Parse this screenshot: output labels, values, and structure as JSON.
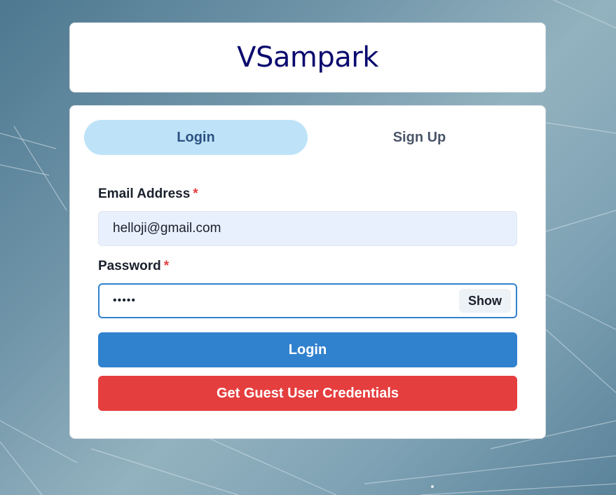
{
  "app": {
    "title": "VSampark"
  },
  "tabs": [
    {
      "label": "Login",
      "active": true
    },
    {
      "label": "Sign Up",
      "active": false
    }
  ],
  "form": {
    "email": {
      "label": "Email Address",
      "required_mark": "*",
      "value": "helloji@gmail.com"
    },
    "password": {
      "label": "Password",
      "required_mark": "*",
      "masked_value": "•••••",
      "toggle_label": "Show"
    },
    "submit_label": "Login",
    "guest_label": "Get Guest User Credentials"
  },
  "colors": {
    "title": "#0a0a6e",
    "active_tab_bg": "#bee3f8",
    "primary_button": "#3182ce",
    "danger_button": "#e53e3e",
    "required_mark": "#e53e3e"
  }
}
